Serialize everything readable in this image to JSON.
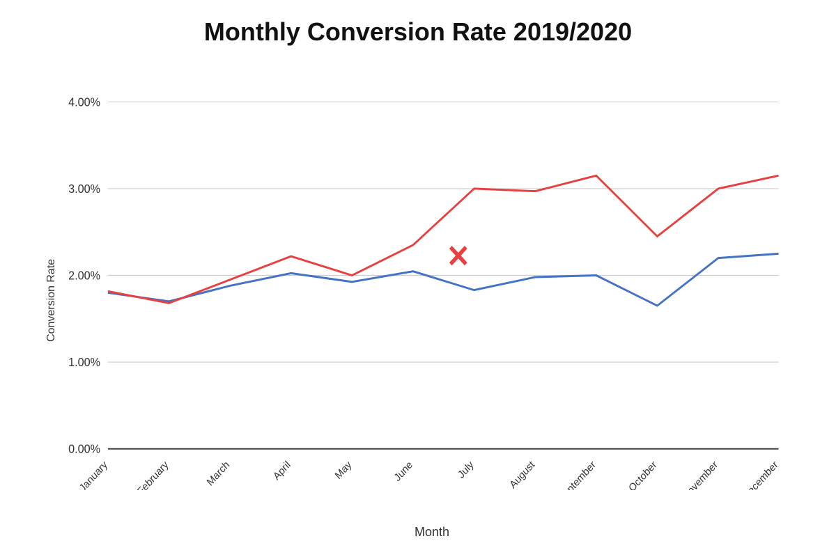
{
  "title": "Monthly Conversion Rate 2019/2020",
  "yAxisLabel": "Conversion Rate",
  "xAxisLabel": "Month",
  "yTicks": [
    "4.00%",
    "3.00%",
    "2.00%",
    "1.00%",
    "0.00%"
  ],
  "months": [
    "January",
    "February",
    "March",
    "April",
    "May",
    "June",
    "July",
    "August",
    "September",
    "October",
    "November",
    "December"
  ],
  "series2019": [
    1.8,
    1.7,
    1.88,
    2.03,
    1.93,
    2.05,
    1.83,
    1.98,
    2.0,
    1.65,
    2.2,
    2.25
  ],
  "series2020": [
    1.82,
    1.68,
    1.95,
    2.22,
    2.0,
    2.35,
    3.0,
    2.97,
    3.15,
    2.45,
    3.0,
    3.15
  ],
  "xMarkLabel": "X",
  "colors": {
    "blue": "#4472c4",
    "red": "#e84040",
    "gridLine": "#cccccc",
    "axisLine": "#333333"
  }
}
